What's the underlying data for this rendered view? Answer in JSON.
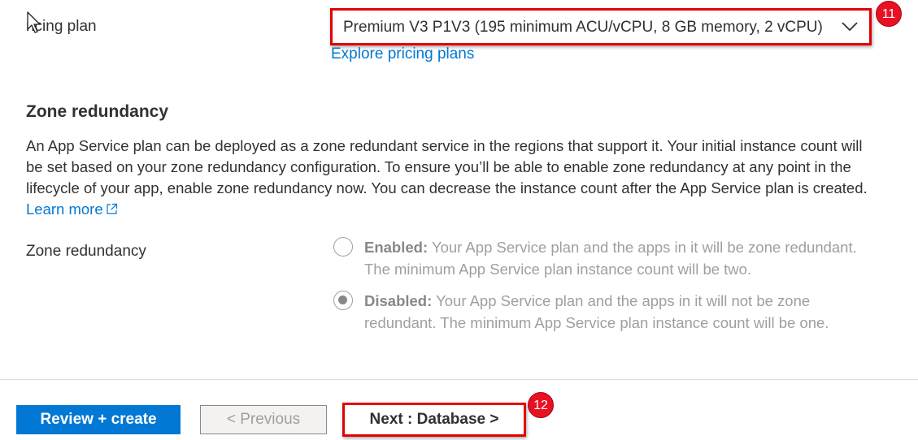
{
  "pricing": {
    "label": "ricing plan",
    "selected_value": "Premium V3 P1V3 (195 minimum ACU/vCPU, 8 GB memory, 2 vCPU)",
    "explore_link": "Explore pricing plans",
    "annotation_badge": "11"
  },
  "zone_redundancy": {
    "heading": "Zone redundancy",
    "description": "An App Service plan can be deployed as a zone redundant service in the regions that support it. Your initial instance count will be set based on your zone redundancy configuration. To ensure you’ll be able to enable zone redundancy at any point in the lifecycle of your app, enable zone redundancy now. You can decrease the instance count after the App Service plan is created.",
    "learn_more": "Learn more",
    "field_label": "Zone redundancy",
    "options": [
      {
        "title": "Enabled:",
        "text": "Your App Service plan and the apps in it will be zone redundant. The minimum App Service plan instance count will be two.",
        "checked": false
      },
      {
        "title": "Disabled:",
        "text": "Your App Service plan and the apps in it will not be zone redundant. The minimum App Service plan instance count will be one.",
        "checked": true
      }
    ]
  },
  "footer": {
    "review_create": "Review + create",
    "previous": "< Previous",
    "next": "Next : Database >",
    "annotation_badge": "12"
  },
  "icons": {
    "cursor": "mouse-pointer-icon",
    "dropdown": "chevron-down-icon",
    "external_link": "external-link-icon"
  },
  "colors": {
    "accent": "#0078d4",
    "highlight": "#e50000",
    "badge": "#e81123"
  }
}
